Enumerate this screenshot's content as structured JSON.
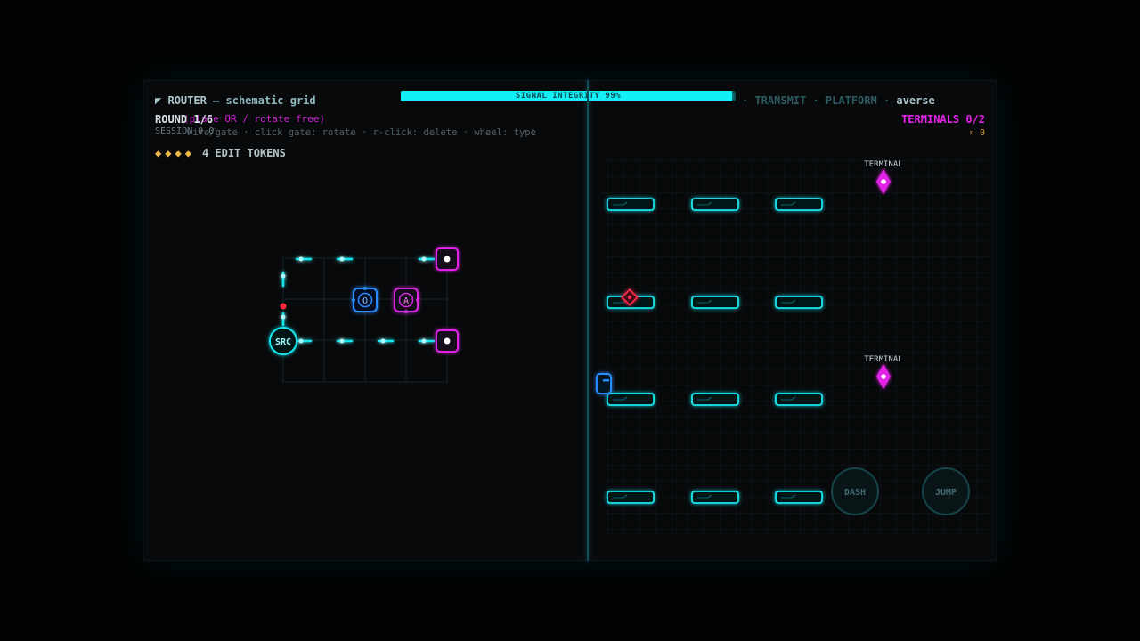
{
  "hud": {
    "signal_integrity": "SIGNAL INTEGRITY  99%",
    "signal_integrity_value": 99,
    "accent_color": "#12f0f6",
    "magenta_color": "#e324e7"
  },
  "router": {
    "title_icon": "◤",
    "title": "ROUTER",
    "subtitle": " — schematic grid",
    "round": "ROUND 1/6",
    "round_hint": "(place OR / rotate free)",
    "session": "SESSION 0 0",
    "controls": "wire/gate · click gate: rotate · r-click: delete · wheel: type",
    "tokens_label": "4 EDIT TOKENS",
    "tokens_count": 4,
    "source_label": "SRC",
    "gate_o_label": "O",
    "gate_a_label": "A"
  },
  "traverse": {
    "title_faded": "· TRANSMIT · PLATFORM ·",
    "title": "averse",
    "terminals": "TERMINALS 0/2",
    "coins": "¤ 0",
    "terminal_label": "TERMINAL",
    "dash_label": "DASH",
    "jump_label": "JUMP"
  }
}
